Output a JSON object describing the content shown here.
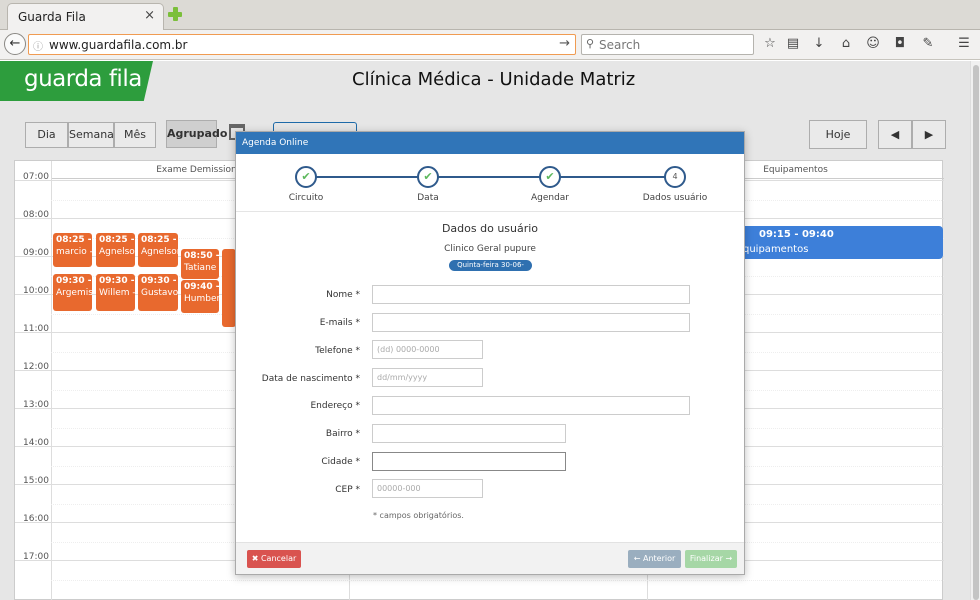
{
  "browser": {
    "tab_title": "Guarda Fila",
    "tab_close": "×",
    "back_glyph": "←",
    "url_info_glyph": "ⓘ",
    "url": "www.guardafila.com.br",
    "url_go_glyph": "→",
    "search_glyph": "⚲",
    "search_placeholder": "Search",
    "toolbar_icons": [
      "star-icon",
      "reading-list-icon",
      "download-icon",
      "home-icon",
      "chat-icon",
      "pocket-icon",
      "extension-icon",
      "menu-icon"
    ],
    "toolbar_glyphs": [
      "☆",
      "▤",
      "↓",
      "⌂",
      "☺",
      "◘",
      "✎",
      "☰"
    ]
  },
  "header": {
    "logo": "guarda fila",
    "title": "Clínica Médica - Unidade Matriz"
  },
  "toolbar": {
    "day": "Dia",
    "week": "Semana",
    "month": "Mês",
    "grouped": "Agrupado",
    "today": "Hoje",
    "prev_glyph": "◀",
    "next_glyph": "▶"
  },
  "calendar": {
    "columns": [
      "Exame Demissional",
      "Equipamentos"
    ],
    "hours": [
      "07:00",
      "08:00",
      "09:00",
      "10:00",
      "11:00",
      "12:00",
      "13:00",
      "14:00",
      "15:00",
      "16:00",
      "17:00"
    ],
    "appointments": [
      {
        "time": "08:25 -",
        "name": "marcio -"
      },
      {
        "time": "08:25 -",
        "name": "Agnelson"
      },
      {
        "time": "08:25 -",
        "name": "Agnelson"
      },
      {
        "time": "08:50 -",
        "name": "Tatiane"
      },
      {
        "time": "09:30 -",
        "name": "Argemisa"
      },
      {
        "time": "09:30 -",
        "name": "Willem -"
      },
      {
        "time": "09:30 -",
        "name": "Gustavo"
      },
      {
        "time": "09:40 -",
        "name": "Humberto"
      }
    ],
    "equipment_event": {
      "time": "09:15 - 09:40",
      "name": "quipamentos"
    }
  },
  "modal": {
    "title": "Agenda Online",
    "steps": [
      {
        "label": "Circuito",
        "mark": "✔"
      },
      {
        "label": "Data",
        "mark": "✔"
      },
      {
        "label": "Agendar",
        "mark": "✔"
      },
      {
        "label": "Dados usuário",
        "mark": "4"
      }
    ],
    "form_title": "Dados do usuário",
    "subtitle": "Clinico Geral pupure",
    "date_badge": "Quinta-feira 30-06-2016",
    "fields": [
      {
        "label": "Nome *",
        "value": "",
        "placeholder": ""
      },
      {
        "label": "E-mails *",
        "value": "",
        "placeholder": ""
      },
      {
        "label": "Telefone *",
        "value": "",
        "placeholder": "(dd) 0000-0000"
      },
      {
        "label": "Data de nascimento *",
        "value": "",
        "placeholder": "dd/mm/yyyy"
      },
      {
        "label": "Endereço *",
        "value": "",
        "placeholder": ""
      },
      {
        "label": "Bairro *",
        "value": "",
        "placeholder": ""
      },
      {
        "label": "Cidade *",
        "value": "",
        "placeholder": ""
      },
      {
        "label": "CEP *",
        "value": "",
        "placeholder": "00000-000"
      }
    ],
    "required_note": "* campos obrigatórios.",
    "cancel": "✖ Cancelar",
    "previous": "← Anterior",
    "finish": "Finalizar →"
  },
  "colors": {
    "brand_green": "#2d9d3d",
    "modal_blue": "#3075b8",
    "appointment_orange": "#e8692e",
    "equipment_blue": "#3d7fd9",
    "cancel_red": "#d9534f"
  }
}
